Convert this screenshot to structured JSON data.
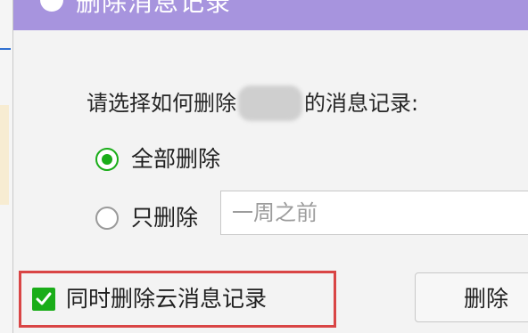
{
  "dialog": {
    "title": "删除消息记录",
    "prompt_before": "请选择如何删除",
    "prompt_after": "的消息记录:",
    "options": {
      "all_label": "全部删除",
      "only_label": "只删除"
    },
    "selected_option": "all",
    "time_input_placeholder": "一周之前",
    "cloud_checkbox_label": "同时删除云消息记录",
    "cloud_checkbox_checked": true,
    "delete_button_label": "删除"
  },
  "colors": {
    "titlebar": "#a794de",
    "accent_green": "#1aad19",
    "highlight_red": "#d94545"
  },
  "icons": {
    "title_icon": "app-circle-icon",
    "check_icon": "checkmark-icon"
  }
}
